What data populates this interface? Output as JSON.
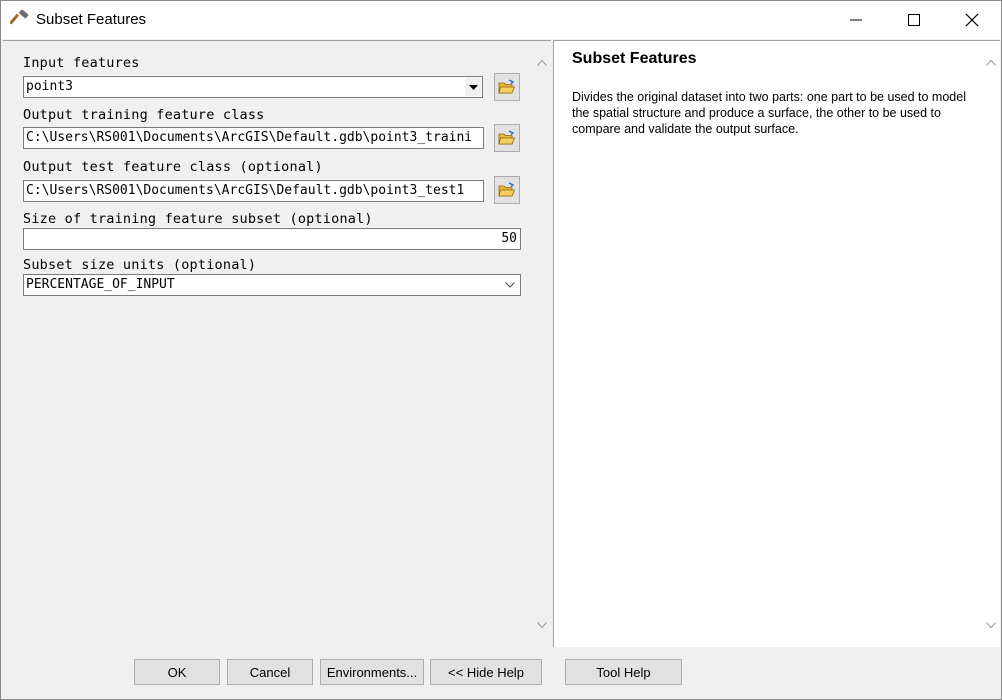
{
  "window": {
    "title": "Subset Features"
  },
  "form": {
    "input_features": {
      "label": "Input features",
      "value": "point3"
    },
    "output_training": {
      "label": "Output training feature class",
      "value": "C:\\Users\\RS001\\Documents\\ArcGIS\\Default.gdb\\point3_traini"
    },
    "output_test": {
      "label": "Output test feature class (optional)",
      "value": "C:\\Users\\RS001\\Documents\\ArcGIS\\Default.gdb\\point3_test1"
    },
    "training_size": {
      "label": "Size of training feature subset (optional)",
      "value": "50"
    },
    "size_units": {
      "label": "Subset size units (optional)",
      "value": "PERCENTAGE_OF_INPUT"
    }
  },
  "help": {
    "title": "Subset Features",
    "description": "Divides the original dataset into two parts: one part to be used to model the spatial structure and produce a surface, the other to be used to compare and validate the output surface."
  },
  "buttons": {
    "ok": "OK",
    "cancel": "Cancel",
    "environments": "Environments...",
    "hide_help": "<< Hide Help",
    "tool_help": "Tool Help"
  },
  "icons": {
    "app": "hammer-icon",
    "browse": "open-folder-icon",
    "minimize": "minimize-icon",
    "maximize": "maximize-icon",
    "close": "close-icon"
  },
  "colors": {
    "folder": "#e8b53a",
    "folder_arrow": "#1f6fd1",
    "border": "#7a7a7a"
  }
}
